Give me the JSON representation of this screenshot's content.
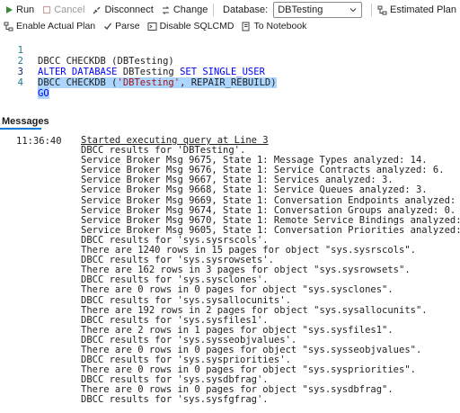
{
  "toolbar": {
    "run_label": "Run",
    "cancel_label": "Cancel",
    "disconnect_label": "Disconnect",
    "change_label": "Change",
    "database_label": "Database:",
    "database_value": "DBTesting",
    "estimated_plan_label": "Estimated Plan",
    "enable_actual_plan_label": "Enable Actual Plan",
    "parse_label": "Parse",
    "disable_sqlcmd_label": "Disable SQLCMD",
    "to_notebook_label": "To Notebook",
    "accent_color": "#0078d4"
  },
  "editor": {
    "line_numbers": [
      "1",
      "2",
      "3",
      "4"
    ],
    "line1": {
      "a": "DBCC CHECKDB (DBTesting)"
    },
    "line2": {
      "a": "ALTER DATABASE",
      "b": " DBTesting ",
      "c": "SET SINGLE_USER"
    },
    "line3": {
      "a": "DBCC CHECKDB (",
      "b": "'DBTesting'",
      "c": ", REPAIR_REBUILD)"
    },
    "line4": {
      "a": "GO"
    }
  },
  "messages": {
    "title": "Messages",
    "timestamp": "11:36:40",
    "lines": [
      "Started executing query at Line 3",
      "DBCC results for 'DBTesting'.",
      "Service Broker Msg 9675, State 1: Message Types analyzed: 14.",
      "Service Broker Msg 9676, State 1: Service Contracts analyzed: 6.",
      "Service Broker Msg 9667, State 1: Services analyzed: 3.",
      "Service Broker Msg 9668, State 1: Service Queues analyzed: 3.",
      "Service Broker Msg 9669, State 1: Conversation Endpoints analyzed: 0.",
      "Service Broker Msg 9674, State 1: Conversation Groups analyzed: 0.",
      "Service Broker Msg 9670, State 1: Remote Service Bindings analyzed: 0.",
      "Service Broker Msg 9605, State 1: Conversation Priorities analyzed: 0.",
      "DBCC results for 'sys.sysrscols'.",
      "There are 1240 rows in 15 pages for object \"sys.sysrscols\".",
      "DBCC results for 'sys.sysrowsets'.",
      "There are 162 rows in 3 pages for object \"sys.sysrowsets\".",
      "DBCC results for 'sys.sysclones'.",
      "There are 0 rows in 0 pages for object \"sys.sysclones\".",
      "DBCC results for 'sys.sysallocunits'.",
      "There are 192 rows in 2 pages for object \"sys.sysallocunits\".",
      "DBCC results for 'sys.sysfiles1'.",
      "There are 2 rows in 1 pages for object \"sys.sysfiles1\".",
      "DBCC results for 'sys.sysseobjvalues'.",
      "There are 0 rows in 0 pages for object \"sys.sysseobjvalues\".",
      "DBCC results for 'sys.syspriorities'.",
      "There are 0 rows in 0 pages for object \"sys.syspriorities\".",
      "DBCC results for 'sys.sysdbfrag'.",
      "There are 0 rows in 0 pages for object \"sys.sysdbfrag\".",
      "DBCC results for 'sys.sysfgfrag'."
    ]
  }
}
